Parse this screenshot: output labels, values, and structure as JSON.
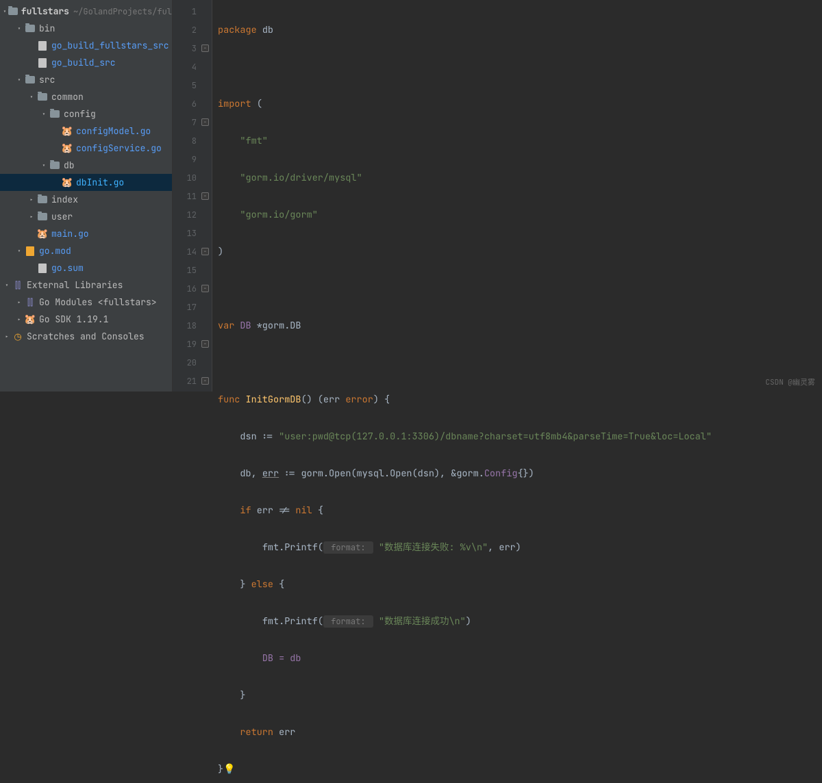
{
  "sidebar": {
    "root": {
      "label": "fullstars",
      "path": "~/GolandProjects/ful"
    },
    "bin": {
      "label": "bin"
    },
    "binA": {
      "label": "go_build_fullstars_src"
    },
    "binB": {
      "label": "go_build_src"
    },
    "src": {
      "label": "src"
    },
    "common": {
      "label": "common"
    },
    "config": {
      "label": "config"
    },
    "cfgModel": {
      "label": "configModel.go"
    },
    "cfgSvc": {
      "label": "configService.go"
    },
    "db": {
      "label": "db"
    },
    "dbInit": {
      "label": "dbInit.go"
    },
    "index": {
      "label": "index"
    },
    "user": {
      "label": "user"
    },
    "main": {
      "label": "main.go"
    },
    "gomod": {
      "label": "go.mod"
    },
    "gosum": {
      "label": "go.sum"
    },
    "extlib": {
      "label": "External Libraries"
    },
    "gomods": {
      "label": "Go Modules <fullstars>"
    },
    "gosdk": {
      "label": "Go SDK 1.19.1"
    },
    "scratch": {
      "label": "Scratches and Consoles"
    }
  },
  "ln": {
    "1": "1",
    "2": "2",
    "3": "3",
    "4": "4",
    "5": "5",
    "6": "6",
    "7": "7",
    "8": "8",
    "9": "9",
    "10": "10",
    "11": "11",
    "12": "12",
    "13": "13",
    "14": "14",
    "15": "15",
    "16": "16",
    "17": "17",
    "18": "18",
    "19": "19",
    "20": "20",
    "21": "21"
  },
  "code": {
    "pkg_kw": "package ",
    "pkg_name": "db",
    "imp_kw": "import ",
    "paren_open": "(",
    "imp1": "\"fmt\"",
    "imp2": "\"gorm.io/driver/mysql\"",
    "imp3": "\"gorm.io/gorm\"",
    "paren_close": ")",
    "var_kw": "var ",
    "var_name": "DB",
    "var_type": " *gorm.DB",
    "func_kw": "func ",
    "func_name": "InitGormDB",
    "func_sig1": "() (err ",
    "func_sig2": "error",
    "func_sig3": ") {",
    "dsn_name": "dsn",
    "assign": " := ",
    "dsn_str": "\"user:pwd@tcp(127.0.0.1:3306)/dbname?charset=utf8mb4&parseTime=True&loc=Local\"",
    "db_name": "db",
    "err_u": "err",
    "gorm_open": " := gorm.Open(mysql.Open(dsn), &gorm.",
    "config_name": "Config",
    "config_suffix": "{})",
    "if_kw": "if ",
    "if_cond": "err != ",
    "nil_kw": "nil",
    "if_open": " {",
    "fmt_call": "fmt.Printf(",
    "hint_format": " format: ",
    "fail_str": "\"数据库连接失败: %v\\n\"",
    "fail_args": ", err)",
    "else_close": "} ",
    "else_kw": "else",
    "else_open": " {",
    "succ_str": "\"数据库连接成功\\n\"",
    "succ_close": ")",
    "db_assign": "DB = db",
    "close_brace": "}",
    "return_kw": "return ",
    "return_var": "err",
    "end_brace": "}"
  },
  "watermark": "CSDN @幽灵雾"
}
